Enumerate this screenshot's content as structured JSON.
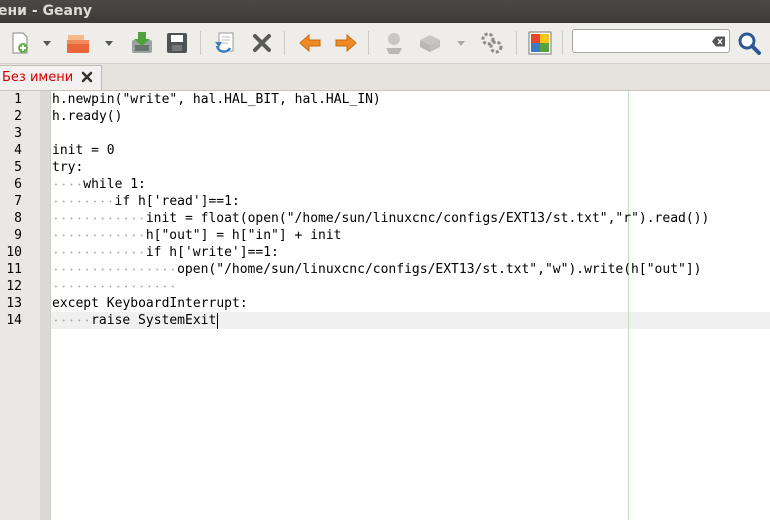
{
  "window": {
    "title": "ени - Geany"
  },
  "toolbar": {
    "icons": [
      "new-file-icon",
      "open-file-icon",
      "save-icon",
      "save-all-icon",
      "revert-icon",
      "close-icon",
      "back-icon",
      "forward-icon",
      "compile-icon",
      "build-icon",
      "execute-icon",
      "color-chooser-icon",
      "search-icon"
    ],
    "search_value": ""
  },
  "tab": {
    "label": "Без имени"
  },
  "editor": {
    "lines": [
      {
        "num": "1",
        "indent": 0,
        "text": "h.newpin(\"write\", hal.HAL_BIT, hal.HAL_IN)"
      },
      {
        "num": "2",
        "indent": 0,
        "text": "h.ready()"
      },
      {
        "num": "3",
        "indent": 0,
        "text": ""
      },
      {
        "num": "4",
        "indent": 0,
        "text": "init = 0"
      },
      {
        "num": "5",
        "indent": 0,
        "text": "try:"
      },
      {
        "num": "6",
        "indent": 4,
        "text": "while 1:"
      },
      {
        "num": "7",
        "indent": 8,
        "text": "if h['read']==1:"
      },
      {
        "num": "8",
        "indent": 12,
        "text": "init = float(open(\"/home/sun/linuxcnc/configs/EXT13/st.txt\",\"r\").read())"
      },
      {
        "num": "9",
        "indent": 12,
        "text": "h[\"out\"] = h[\"in\"] + init"
      },
      {
        "num": "10",
        "indent": 12,
        "text": "if h['write']==1:"
      },
      {
        "num": "11",
        "indent": 16,
        "text": "open(\"/home/sun/linuxcnc/configs/EXT13/st.txt\",\"w\").write(h[\"out\"])"
      },
      {
        "num": "12",
        "indent": 16,
        "text": ""
      },
      {
        "num": "13",
        "indent": 0,
        "text": "except KeyboardInterrupt:"
      },
      {
        "num": "14",
        "indent": 5,
        "text": "raise SystemExit"
      }
    ]
  }
}
